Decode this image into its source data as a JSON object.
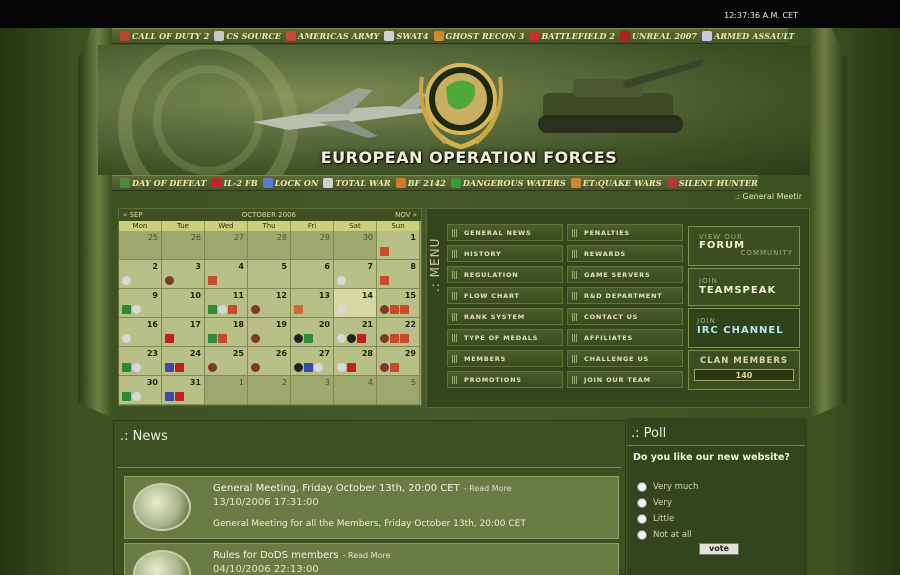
{
  "clock": "12:37:36 A.M. CET",
  "site_title": "EUROPEAN OPERATION FORCES",
  "games_top": [
    {
      "label": "CALL OF DUTY 2",
      "color": "#b54a2a"
    },
    {
      "label": "CS SOURCE",
      "color": "#c8c8c8"
    },
    {
      "label": "AMERICAS ARMY",
      "color": "#c94a3a"
    },
    {
      "label": "SWAT4",
      "color": "#d0d0d0"
    },
    {
      "label": "GHOST RECON 3",
      "color": "#d08a2a"
    },
    {
      "label": "BATTLEFIELD 2",
      "color": "#c23030"
    },
    {
      "label": "UNREAL 2007",
      "color": "#b02020"
    },
    {
      "label": "ARMED ASSAULT",
      "color": "#c9c9e8"
    }
  ],
  "games_bottom": [
    {
      "label": "DAY OF DEFEAT",
      "color": "#4a8a3a"
    },
    {
      "label": "IL-2 FB",
      "color": "#c02828"
    },
    {
      "label": "LOCK ON",
      "color": "#5a7ad0"
    },
    {
      "label": "TOTAL WAR",
      "color": "#d0d0d0"
    },
    {
      "label": "BF 2142",
      "color": "#d07a2a"
    },
    {
      "label": "DANGEROUS WATERS",
      "color": "#3a9a3a"
    },
    {
      "label": "ET:QUAKE WARS",
      "color": "#c88a3a"
    },
    {
      "label": "SILENT HUNTER",
      "color": "#b03a3a"
    }
  ],
  "ticker": ".: General Meetir",
  "calendar": {
    "prev": "« SEP",
    "month": "OCTOBER 2006",
    "next": "NOV »",
    "weekdays": [
      "Mon",
      "Tue",
      "Wed",
      "Thu",
      "Fri",
      "Sat",
      "Sun"
    ],
    "weeks": [
      [
        {
          "d": "25",
          "out": true
        },
        {
          "d": "26",
          "out": true
        },
        {
          "d": "27",
          "out": true
        },
        {
          "d": "28",
          "out": true
        },
        {
          "d": "29",
          "out": true
        },
        {
          "d": "30",
          "out": true
        },
        {
          "d": "1",
          "ev": [
            "r"
          ]
        }
      ],
      [
        {
          "d": "2",
          "ev": [
            "g"
          ]
        },
        {
          "d": "3",
          "ev": [
            "b"
          ]
        },
        {
          "d": "4",
          "ev": [
            "r"
          ]
        },
        {
          "d": "5"
        },
        {
          "d": "6"
        },
        {
          "d": "7",
          "ev": [
            "g"
          ]
        },
        {
          "d": "8",
          "ev": [
            "r"
          ]
        }
      ],
      [
        {
          "d": "9",
          "ev": [
            "f",
            "g"
          ]
        },
        {
          "d": "10"
        },
        {
          "d": "11",
          "ev": [
            "f",
            "g",
            "r"
          ]
        },
        {
          "d": "12",
          "ev": [
            "b"
          ]
        },
        {
          "d": "13",
          "ev": [
            "s"
          ]
        },
        {
          "d": "14",
          "ev": [
            "g"
          ],
          "today": true
        },
        {
          "d": "15",
          "ev": [
            "b",
            "r",
            "r"
          ]
        }
      ],
      [
        {
          "d": "16",
          "ev": [
            "g"
          ]
        },
        {
          "d": "17",
          "ev": [
            "z"
          ]
        },
        {
          "d": "18",
          "ev": [
            "f",
            "r"
          ]
        },
        {
          "d": "19",
          "ev": [
            "b"
          ]
        },
        {
          "d": "20",
          "ev": [
            "k",
            "f"
          ]
        },
        {
          "d": "21",
          "ev": [
            "g",
            "k",
            "z"
          ]
        },
        {
          "d": "22",
          "ev": [
            "b",
            "r",
            "r"
          ]
        }
      ],
      [
        {
          "d": "23",
          "ev": [
            "f",
            "g"
          ]
        },
        {
          "d": "24",
          "ev": [
            "a",
            "z"
          ]
        },
        {
          "d": "25",
          "ev": [
            "b"
          ]
        },
        {
          "d": "26",
          "ev": [
            "b"
          ]
        },
        {
          "d": "27",
          "ev": [
            "k",
            "a",
            "g"
          ]
        },
        {
          "d": "28",
          "ev": [
            "g",
            "z"
          ]
        },
        {
          "d": "29",
          "ev": [
            "b",
            "r"
          ]
        }
      ],
      [
        {
          "d": "30",
          "ev": [
            "f",
            "g"
          ]
        },
        {
          "d": "31",
          "ev": [
            "a",
            "z"
          ]
        },
        {
          "d": "1",
          "out": true
        },
        {
          "d": "2",
          "out": true
        },
        {
          "d": "3",
          "out": true
        },
        {
          "d": "4",
          "out": true
        },
        {
          "d": "5",
          "out": true
        }
      ]
    ]
  },
  "menu": {
    "title": ".: MENU",
    "left": [
      "GENERAL NEWS",
      "HISTORY",
      "REGULATION",
      "FLOW CHART",
      "RANK SYSTEM",
      "TYPE OF MEDALS",
      "MEMBERS",
      "PROMOTIONS"
    ],
    "right": [
      "PENALTIES",
      "REWARDS",
      "GAME SERVERS",
      "R&D DEPARTMENT",
      "CONTACT US",
      "AFFILIATES",
      "CHALLENGE US",
      "JOIN OUR TEAM"
    ]
  },
  "side": {
    "forum": {
      "l1": "VIEW OUR",
      "l2": "FORUM",
      "l3": "COMMUNITY"
    },
    "teamspeak": {
      "l1": "JOIN",
      "l2": "TEAMSPEAK"
    },
    "irc": {
      "l1": "JOIN",
      "l2": "IRC CHANNEL"
    },
    "clan": {
      "l1": "CLAN MEMBERS",
      "count": "140"
    }
  },
  "news": {
    "title": ".: News",
    "read_more": "- Read More",
    "items": [
      {
        "headline": "General Meeting, Friday October 13th, 20:00 CET",
        "date": "13/10/2006 17:31:00",
        "body": "General Meeting for all the Members, Friday October 13th, 20:00 CET"
      },
      {
        "headline": "Rules for DoDS members",
        "date": "04/10/2006 22:13:00",
        "body": ""
      }
    ]
  },
  "poll": {
    "title": ".: Poll",
    "question": "Do you like our new website?",
    "options": [
      "Very much",
      "Very",
      "Little",
      "Not at all"
    ],
    "vote_label": "vote"
  }
}
